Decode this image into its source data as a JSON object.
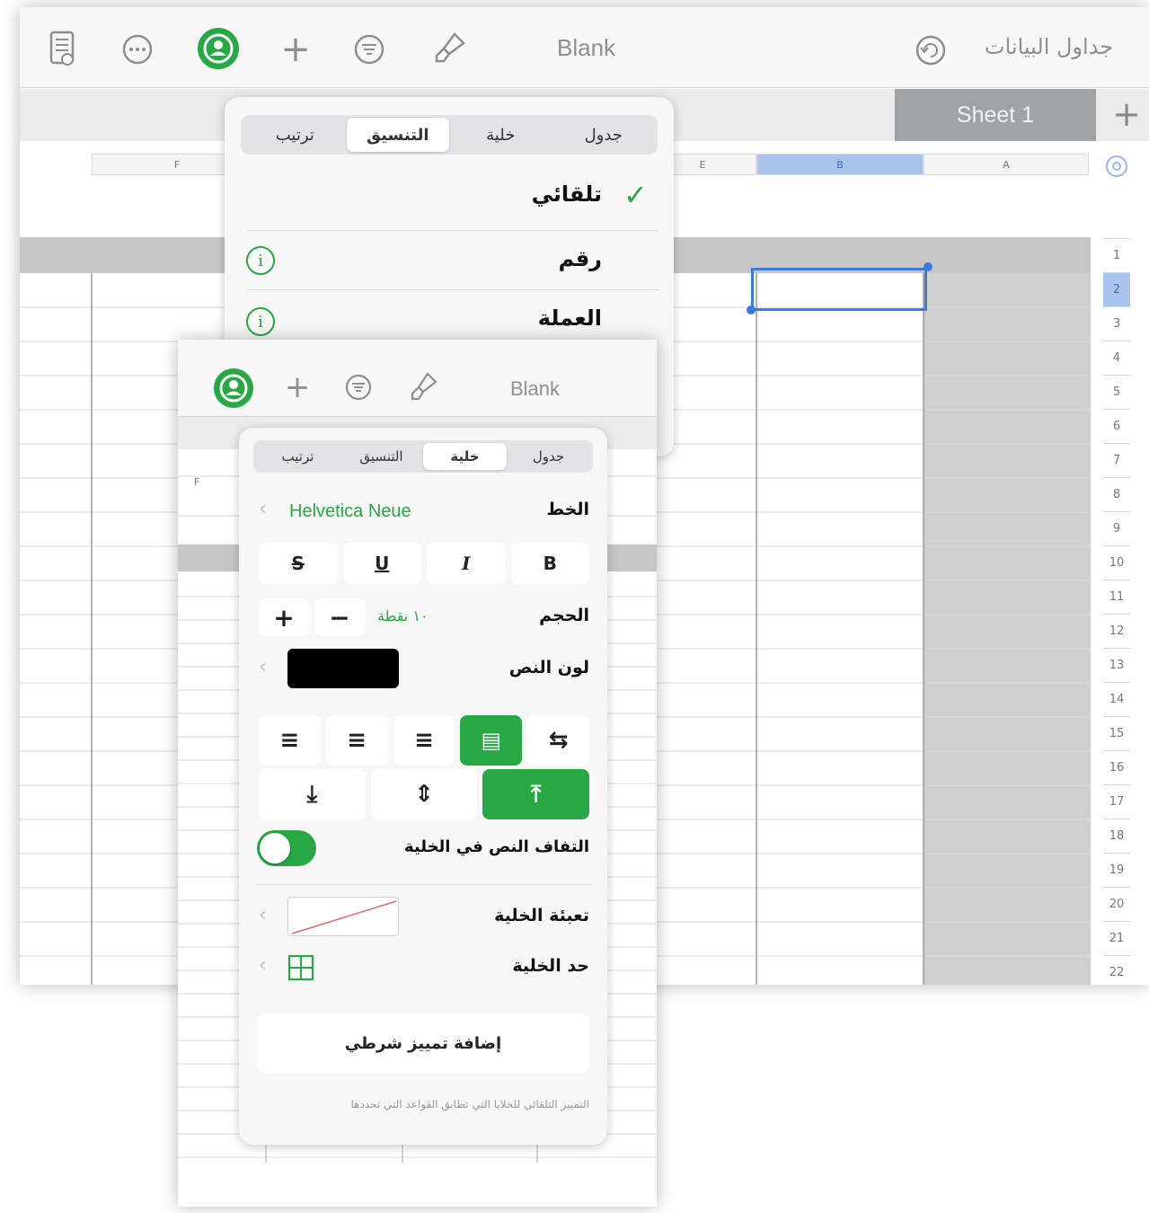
{
  "back_window": {
    "title": "Blank",
    "app_title": "جداول البيانات",
    "sheet_tab": "Sheet 1",
    "columns": [
      "A",
      "B",
      "E",
      "F"
    ],
    "rows": [
      "1",
      "2",
      "3",
      "4",
      "5",
      "6",
      "7",
      "8",
      "9",
      "10",
      "11",
      "12",
      "13",
      "14",
      "15",
      "16",
      "17",
      "18",
      "19",
      "20",
      "21",
      "22"
    ]
  },
  "format_popover": {
    "tabs": [
      "جدول",
      "خلية",
      "التنسيق",
      "ترتيب"
    ],
    "active_tab": "التنسيق",
    "options": [
      {
        "label": "تلقائي",
        "checked": true
      },
      {
        "label": "رقم"
      },
      {
        "label": "العملة"
      }
    ]
  },
  "front_window": {
    "title": "Blank",
    "column_label": "F",
    "cell_popover": {
      "tabs": [
        "جدول",
        "خلية",
        "التنسيق",
        "ترتيب"
      ],
      "active_tab": "خلية",
      "font_label": "الخط",
      "font_value": "Helvetica Neue",
      "style_buttons": [
        "B",
        "I",
        "U",
        "S"
      ],
      "size_label": "الحجم",
      "size_value": "١٠ نقطة",
      "text_color_label": "لون النص",
      "text_color": "#000000",
      "wrap_label": "التفاف النص في الخلية",
      "wrap_on": true,
      "fill_label": "تعبئة الخلية",
      "border_label": "حد الخلية",
      "conditional_button": "إضافة تمييز شرطي",
      "footer_note": "التمييز التلقائي للخلايا التي تطابق القواعد التي تحددها"
    }
  },
  "accent_color": "#27a844",
  "selection_color": "#3d7bdb"
}
